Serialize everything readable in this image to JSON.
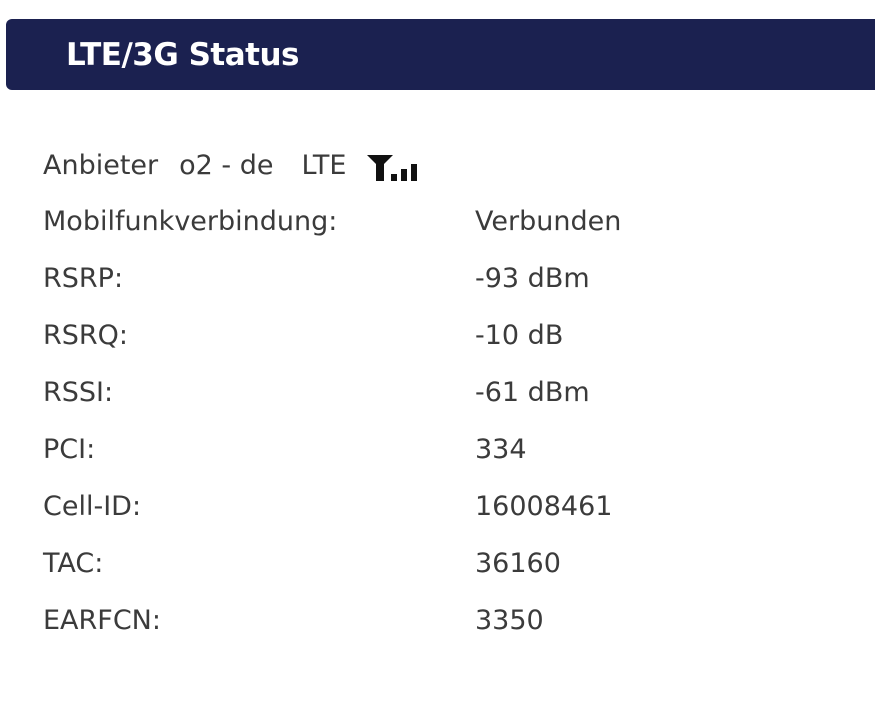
{
  "header": {
    "title": "LTE/3G Status"
  },
  "provider": {
    "label": "Anbieter",
    "name": "o2 - de",
    "technology": "LTE",
    "signal_icon": "antenna-signal-bars-icon",
    "signal_bars_filled": 3,
    "signal_bars_total": 3
  },
  "status_rows": [
    {
      "label": "Mobilfunkverbindung:",
      "value": "Verbunden"
    },
    {
      "label": "RSRP:",
      "value": "-93 dBm"
    },
    {
      "label": "RSRQ:",
      "value": "-10 dB"
    },
    {
      "label": "RSSI:",
      "value": "-61 dBm"
    },
    {
      "label": "PCI:",
      "value": "334"
    },
    {
      "label": "Cell-ID:",
      "value": "16008461"
    },
    {
      "label": "TAC:",
      "value": "36160"
    },
    {
      "label": "EARFCN:",
      "value": "3350"
    }
  ],
  "colors": {
    "header_background": "#1b2150",
    "header_text": "#ffffff",
    "body_text": "#3b3b3b"
  }
}
